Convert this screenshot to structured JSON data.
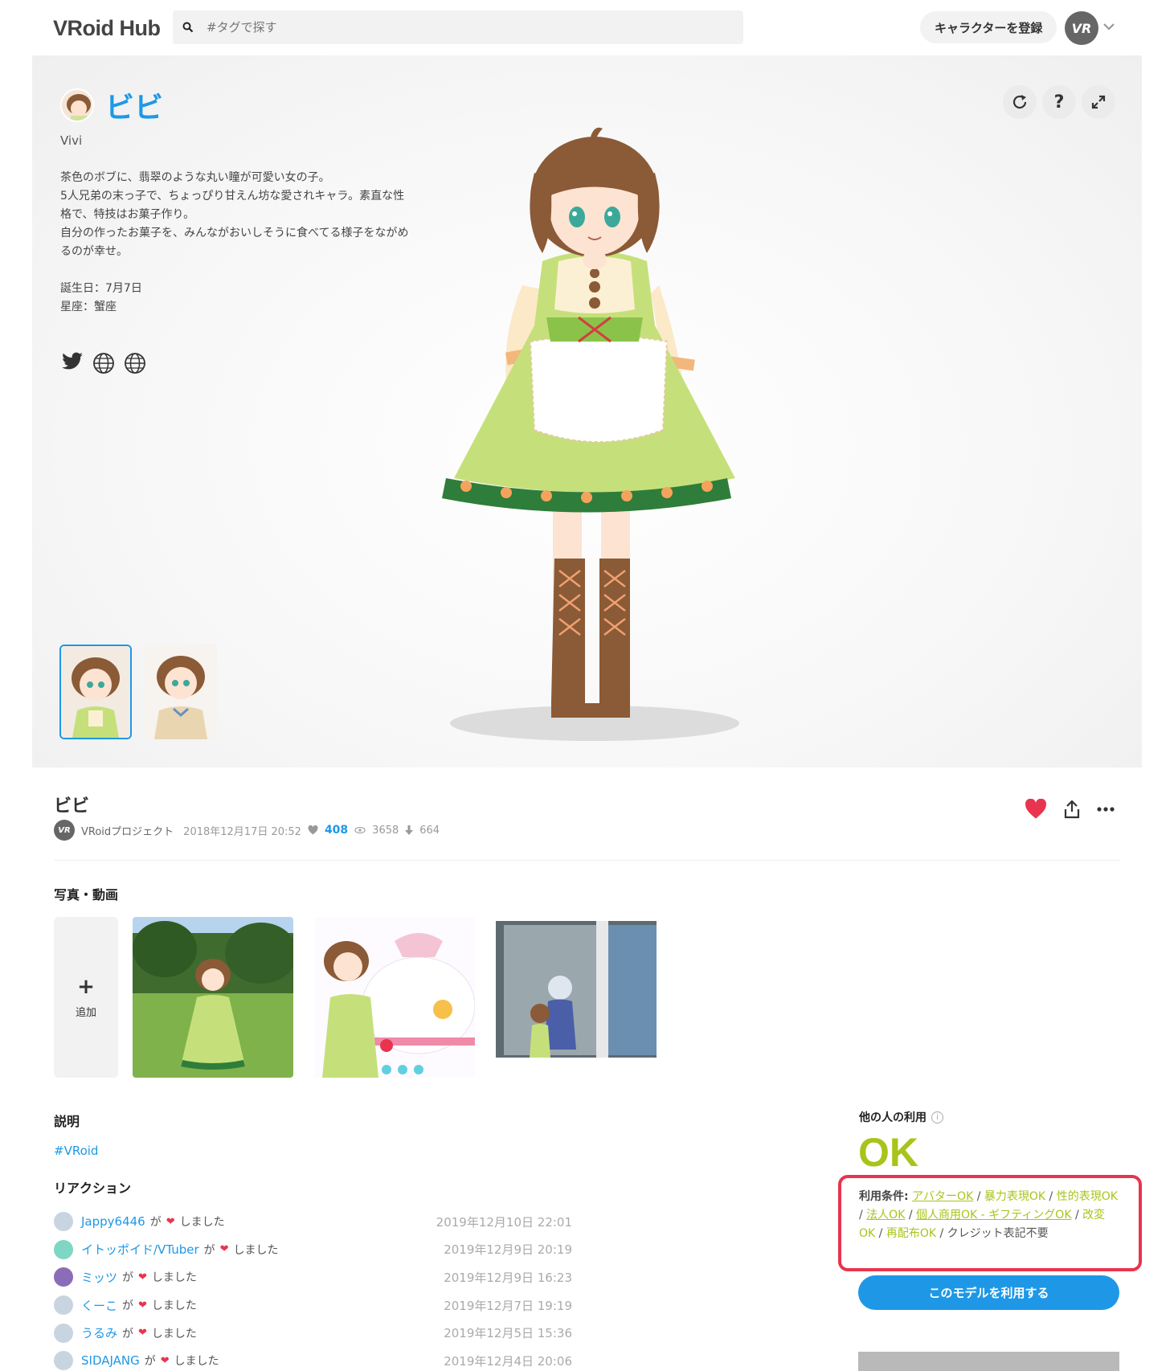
{
  "header": {
    "logo": "VRoid Hub",
    "search_placeholder": "#タグで探す",
    "register_label": "キャラクターを登録",
    "avatar_text": "VR"
  },
  "character": {
    "name": "ビビ",
    "subtitle": "Vivi",
    "description": "茶色のボブに、翡翠のような丸い瞳が可愛い女の子。\n5人兄弟の末っ子で、ちょっぴり甘えん坊な愛されキャラ。素直な性格で、特技はお菓子作り。\n自分の作ったお菓子を、みんながおいしそうに食べてる様子をながめるのが幸せ。\n\n誕生日：7月7日\n星座：蟹座"
  },
  "viewer": {
    "tools": [
      "reload-icon",
      "help-icon",
      "fullscreen-icon"
    ],
    "help_label": "?"
  },
  "model": {
    "title": "ビビ",
    "author_avatar": "VR",
    "author": "VRoidプロジェクト",
    "date": "2018年12月17日 20:52",
    "likes": "408",
    "views": "3658",
    "downloads": "664"
  },
  "photos": {
    "heading": "写真・動画",
    "add_label": "追加"
  },
  "description": {
    "heading": "説明",
    "hashtag": "#VRoid"
  },
  "reactions": {
    "heading": "リアクション",
    "connector": "が",
    "suffix": "しました",
    "items": [
      {
        "user": "Jappy6446",
        "date": "2019年12月10日 22:01",
        "color": "#c8d4e0"
      },
      {
        "user": "イトッポイド/VTuber",
        "date": "2019年12月9日 20:19",
        "color": "#7fd6c4"
      },
      {
        "user": "ミッツ",
        "date": "2019年12月9日 16:23",
        "color": "#8a6db8"
      },
      {
        "user": "くーこ",
        "date": "2019年12月7日 19:19",
        "color": "#c8d4e0"
      },
      {
        "user": "うるみ",
        "date": "2019年12月5日 15:36",
        "color": "#c8d4e0"
      },
      {
        "user": "SIDAJANG",
        "date": "2019年12月4日 20:06",
        "color": "#c8d4e0"
      }
    ]
  },
  "usage": {
    "heading": "他の人の利用",
    "info": "i",
    "status": "OK",
    "terms_label": "利用条件:",
    "terms": {
      "avatar": "アバターOK",
      "violence": "暴力表現OK",
      "sexual": "性的表現OK",
      "corporate": "法人OK",
      "commercial": "個人商用OK - ギフティングOK",
      "modify": "改変OK",
      "redistribute": "再配布OK",
      "credit": "クレジット表記不要"
    },
    "use_button": "このモデルを利用する"
  },
  "colors": {
    "accent": "#1e98e6",
    "ok_green": "#a8c41c",
    "highlight_red": "#e8344e"
  }
}
